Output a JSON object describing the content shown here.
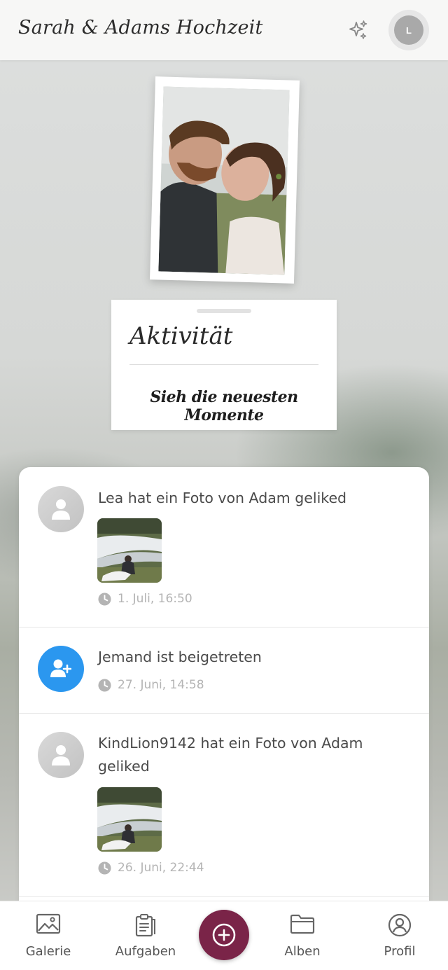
{
  "header": {
    "title": "Sarah & Adams Hochzeit",
    "avatar_initial": "L",
    "icons": [
      "sparkles-icon",
      "profile-avatar"
    ]
  },
  "activity": {
    "title": "Aktivität",
    "subtitle": "Sieh die neuesten Momente"
  },
  "feed": {
    "items": [
      {
        "text": "Lea hat ein Foto von Adam geliked",
        "timestamp": "1. Juli, 16:50",
        "type": "like"
      },
      {
        "text": "Jemand ist beigetreten",
        "timestamp": "27. Juni, 14:58",
        "type": "join"
      },
      {
        "text": "KindLion9142 hat ein Foto von Adam geliked",
        "timestamp": "26. Juni, 22:44",
        "type": "like"
      }
    ]
  },
  "nav": {
    "items": [
      {
        "label": "Galerie",
        "icon": "image-icon"
      },
      {
        "label": "Aufgaben",
        "icon": "clipboard-icon"
      },
      {
        "label": "Alben",
        "icon": "folder-icon"
      },
      {
        "label": "Profil",
        "icon": "user-circle-icon"
      }
    ],
    "fab_icon": "plus-circle-icon"
  },
  "colors": {
    "accent": "#7a2448",
    "join_blue": "#2b97ef",
    "muted_text": "#b4b4b4"
  }
}
